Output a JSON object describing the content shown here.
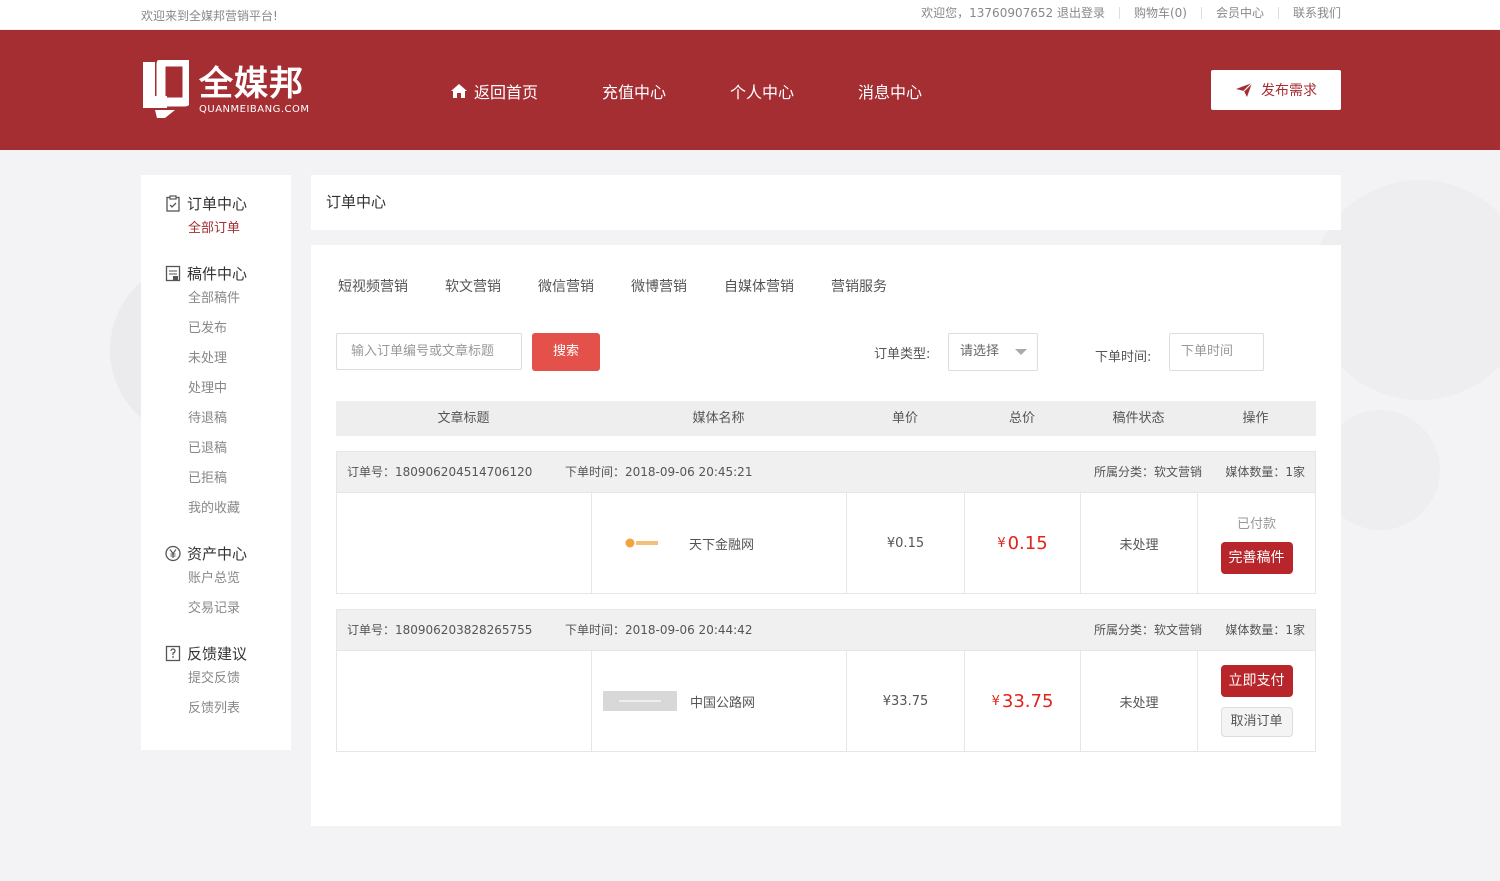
{
  "topbar": {
    "welcome": "欢迎来到全媒邦营销平台!",
    "user_greeting": "欢迎您，13760907652 退出登录",
    "cart": "购物车(0)",
    "member_center": "会员中心",
    "contact": "联系我们"
  },
  "header": {
    "logo_cn": "全媒邦",
    "logo_en": "QUANMEIBANG.COM",
    "nav": [
      {
        "label": "返回首页",
        "icon": "home-icon"
      },
      {
        "label": "充值中心"
      },
      {
        "label": "个人中心"
      },
      {
        "label": "消息中心"
      }
    ],
    "publish_label": "发布需求",
    "colors": {
      "brand": "#a52e33",
      "accent_red": "#e3514a",
      "price_red": "#e2231a"
    }
  },
  "sidebar": {
    "groups": [
      {
        "title": "订单中心",
        "icon": "clipboard-icon",
        "items": [
          "全部订单"
        ]
      },
      {
        "title": "稿件中心",
        "icon": "document-icon",
        "items": [
          "全部稿件",
          "已发布",
          "未处理",
          "处理中",
          "待退稿",
          "已退稿",
          "已拒稿",
          "我的收藏"
        ]
      },
      {
        "title": "资产中心",
        "icon": "yen-icon",
        "items": [
          "账户总览",
          "交易记录"
        ]
      },
      {
        "title": "反馈建议",
        "icon": "feedback-icon",
        "items": [
          "提交反馈",
          "反馈列表"
        ]
      }
    ],
    "active_item": "全部订单"
  },
  "main": {
    "title": "订单中心",
    "tabs": [
      "短视频营销",
      "软文营销",
      "微信营销",
      "微博营销",
      "自媒体营销",
      "营销服务"
    ],
    "search": {
      "placeholder": "输入订单编号或文章标题",
      "button": "搜索"
    },
    "filter": {
      "type_label": "订单类型:",
      "type_value": "请选择",
      "time_label": "下单时间:",
      "time_placeholder": "下单时间"
    },
    "columns": [
      "文章标题",
      "媒体名称",
      "单价",
      "总价",
      "稿件状态",
      "操作"
    ],
    "orders": [
      {
        "order_no": "订单号：180906204514706120",
        "order_time": "下单时间：2018-09-06 20:45:21",
        "category": "所属分类：软文营销",
        "media_count": "媒体数量：1家",
        "article_title": "",
        "media_name": "天下金融网",
        "unit_price": "¥0.15",
        "total_symbol": "¥",
        "total_value": "0.15",
        "status": "未处理",
        "paid_text": "已付款",
        "action_primary": "完善稿件"
      },
      {
        "order_no": "订单号：180906203828265755",
        "order_time": "下单时间：2018-09-06 20:44:42",
        "category": "所属分类：软文营销",
        "media_count": "媒体数量：1家",
        "article_title": "",
        "media_name": "中国公路网",
        "unit_price": "¥33.75",
        "total_symbol": "¥",
        "total_value": "33.75",
        "status": "未处理",
        "action_primary": "立即支付",
        "action_secondary": "取消订单"
      }
    ]
  }
}
